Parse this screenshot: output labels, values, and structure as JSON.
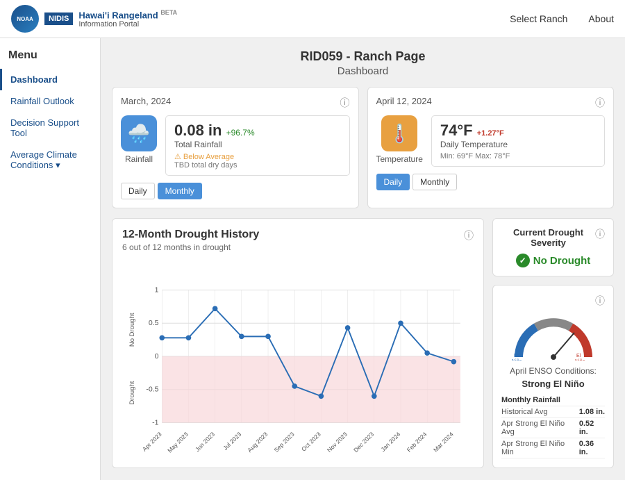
{
  "header": {
    "logo_text": "NOAA",
    "nidis_label": "NIDIS",
    "title": "Hawai'i Rangeland",
    "subtitle": "Information Portal",
    "beta": "BETA",
    "nav": {
      "select_ranch": "Select Ranch",
      "about": "About"
    }
  },
  "sidebar": {
    "menu_label": "Menu",
    "items": [
      {
        "id": "dashboard",
        "label": "Dashboard"
      },
      {
        "id": "rainfall-outlook",
        "label": "Rainfall Outlook"
      },
      {
        "id": "decision-support",
        "label": "Decision Support Tool"
      },
      {
        "id": "avg-climate",
        "label": "Average Climate Conditions"
      }
    ]
  },
  "main": {
    "page_title": "RID059 - Ranch Page",
    "page_subtitle": "Dashboard",
    "rainfall_card": {
      "label": "Rainfall",
      "date": "March, 2024",
      "total_label": "Total Rainfall",
      "total_value": "0.08 in",
      "pct_change": "+96.7%",
      "status": "Below Average",
      "note": "TBD total dry days",
      "btn_daily": "Daily",
      "btn_monthly": "Monthly",
      "active_btn": "monthly"
    },
    "temperature_card": {
      "label": "Temperature",
      "date": "April 12, 2024",
      "temp_value": "74°F",
      "temp_delta": "+1.27°F",
      "temp_label": "Daily Temperature",
      "temp_range": "Min: 69°F  Max: 78°F",
      "btn_daily": "Daily",
      "btn_monthly": "Monthly",
      "active_btn": "daily"
    },
    "drought_chart": {
      "title": "12-Month Drought History",
      "subtitle": "6 out of 12 months in drought",
      "info_icon": "?",
      "y_label_top": "No Drought",
      "y_label_bottom": "Drought",
      "y_max": "1",
      "y_mid": "0",
      "y_min": "-1",
      "x_labels": [
        "Apr 2023",
        "May 2023",
        "Jun 2023",
        "Jul 2023",
        "Aug 2023",
        "Sep 2023",
        "Oct 2023",
        "Nov 2023",
        "Dec 2023",
        "Jan 2024",
        "Feb 2024",
        "Mar 2024"
      ]
    },
    "drought_severity": {
      "title": "Current Drought Severity",
      "value": "No Drought",
      "info_icon": "?"
    },
    "enso_card": {
      "info_icon": "?",
      "gauge_label": "April ENSO Conditions:",
      "gauge_value": "Strong El Niño",
      "table": {
        "section_label": "Monthly Rainfall",
        "rows": [
          {
            "label": "Historical Avg",
            "value": "1.08 in."
          },
          {
            "label": "Apr Strong El Niño Avg",
            "value": "0.52 in."
          },
          {
            "label": "Apr Strong El Niño Min",
            "value": "0.36 in."
          }
        ]
      }
    }
  }
}
